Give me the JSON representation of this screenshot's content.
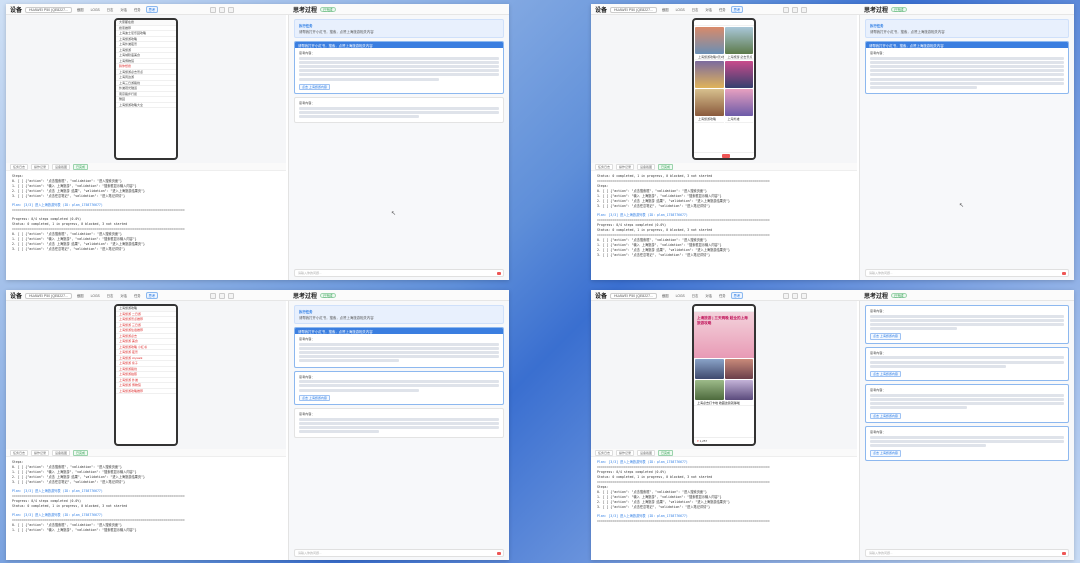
{
  "app": {
    "title": "设备",
    "device": "HUAWEI P50 (QE8227...",
    "nav": [
      "截图",
      "LOGS",
      "日志",
      "对话",
      "任务",
      "思考"
    ],
    "active_nav": "思考"
  },
  "thinking": {
    "title": "思考过程",
    "status": "已完成",
    "task_label": "执行任务",
    "task_text": "请帮我打开小红书，搜索，点赞上海旅游相关内容",
    "step_label": "思考内容：",
    "action_button": "点击 上海旅游内容",
    "input_placeholder": "请输入你的问题..."
  },
  "log_tabs": [
    "任务日志",
    "操作记录",
    "设备截图",
    "已完成"
  ],
  "log": {
    "steps_header": "Steps:",
    "lines": [
      "0. [ ] {\"action\": \"点击搜索框\", \"validation\": \"进入搜索页面\"}",
      "1. [ ] {\"action\": \"输入 上海旅游\", \"validation\": \"搜索框显示输入内容\"}",
      "2. [ ] {\"action\": \"点击 上海旅游 结果\", \"validation\": \"进入上海旅游结果页\"}",
      "3. [ ] {\"action\": \"点击任意笔记\", \"validation\": \"进入笔记详情\"}"
    ],
    "progress": "Progress: 0/4 steps completed (0.0%)",
    "status": "Status: 0 completed, 1 in progress, 0 blocked, 3 not started",
    "plan_line": "Plan: [3/3] 进入上海旅游列表 (ID: plan_1758776677)",
    "divider": "=========================================================================================="
  },
  "panels": {
    "tl": {
      "phone_rows": [
        "搜索推荐",
        "上海迪士尼乐园攻略",
        "上海旅游攻略",
        "上海外滩夜景",
        "上海旅游",
        "上海城隍庙美食",
        "上海博物馆",
        "上海旅游必去景点",
        "上海周边游",
        "上海三日游路线",
        "外滩观光隧道",
        "南京路步行街",
        "豫园",
        "上海旅游攻略大全"
      ],
      "section": "大家都在搜",
      "hot_label": "猜你想搜"
    },
    "tr": {
      "caption_a": "上海旅游攻略3天2晚",
      "caption_b": "上海旅游 必去景点",
      "caption_c": "上海旅游攻略",
      "caption_d": "上海外滩"
    },
    "bl": {
      "phone_rows": [
        "上海旅游攻略",
        "上海旅游 二日游",
        "上海旅游景点推荐",
        "上海旅游 三日游",
        "上海旅游住宿推荐",
        "上海旅游必去",
        "上海旅游 美食",
        "上海旅游攻略 小红书",
        "上海旅游 夜景",
        "上海旅游 citywalk",
        "上海旅游 亲子",
        "上海旅游路线",
        "上海旅游拍照",
        "上海旅游 外滩",
        "上海旅游 博物馆",
        "上海旅游攻略推荐"
      ]
    },
    "br": {
      "post_title": "上海旅游 | 三天两晚 超全的上海旅游攻略",
      "post_caption": "上海必去打卡地 收藏这篇就够啦",
      "likes": "1,257"
    }
  },
  "colors": {
    "accent": "#3a7ee0",
    "success": "#2e9b4f",
    "alert": "#e55555"
  }
}
